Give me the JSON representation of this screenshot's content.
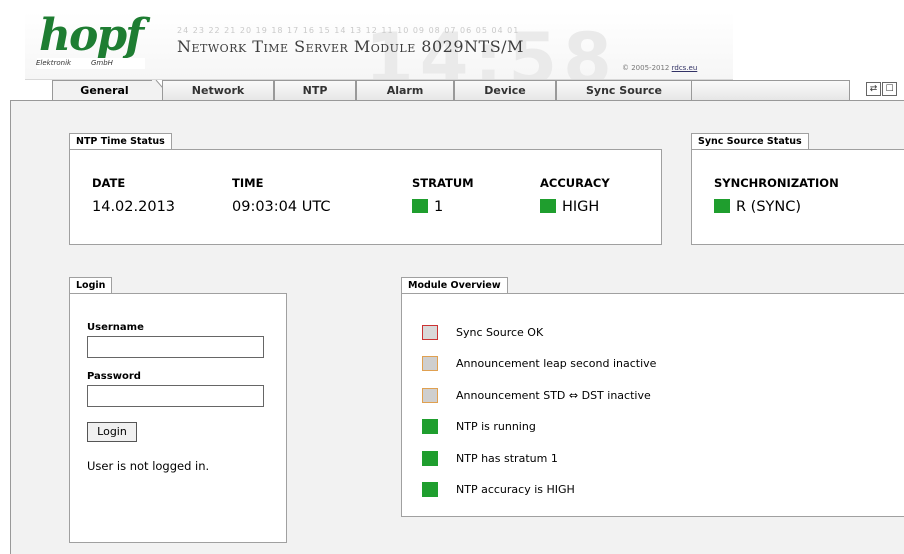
{
  "header": {
    "logo_word": "hopf",
    "logo_sub_left": "Elektronik",
    "logo_sub_right": "GmbH",
    "digit_strip": "24 23 22 21 20 19 18 17 16 15 14 13 12 11 10 09 08 07 06 05 04 01",
    "title": "Network Time Server Module 8029NTS/M",
    "copyright": "© 2005-2012",
    "copyright_link": "rdcs.eu"
  },
  "tabs": [
    {
      "label": "General",
      "active": true
    },
    {
      "label": "Network",
      "active": false
    },
    {
      "label": "NTP",
      "active": false
    },
    {
      "label": "Alarm",
      "active": false
    },
    {
      "label": "Device",
      "active": false
    },
    {
      "label": "Sync Source",
      "active": false
    }
  ],
  "window_icons": [
    "refresh-icon",
    "popout-icon"
  ],
  "ntp_status": {
    "title": "NTP Time Status",
    "date_label": "DATE",
    "date_value": "14.02.2013",
    "time_label": "TIME",
    "time_value": "09:03:04 UTC",
    "stratum_label": "STRATUM",
    "stratum_value": "1",
    "accuracy_label": "ACCURACY",
    "accuracy_value": "HIGH",
    "indicator_color": "#1f9e2e"
  },
  "sync_status": {
    "title": "Sync Source Status",
    "label": "SYNCHRONIZATION",
    "value": "R (SYNC)"
  },
  "login": {
    "title": "Login",
    "username_label": "Username",
    "username_value": "",
    "password_label": "Password",
    "password_value": "",
    "button_label": "Login",
    "status_text": "User is not logged in."
  },
  "module_overview": {
    "title": "Module Overview",
    "items": [
      {
        "text": "Sync Source OK",
        "status": "red-outline"
      },
      {
        "text": "Announcement leap second inactive",
        "status": "orange-outline"
      },
      {
        "text": "Announcement STD ⇔ DST inactive",
        "status": "orange-outline"
      },
      {
        "text": "NTP is running",
        "status": "green"
      },
      {
        "text": "NTP has stratum 1",
        "status": "green"
      },
      {
        "text": "NTP accuracy is HIGH",
        "status": "green"
      }
    ]
  },
  "colors": {
    "brand_green": "#1e7d32",
    "status_green": "#1f9e2e",
    "status_red": "#cc3333",
    "status_orange": "#e0a050",
    "content_bg": "#f2f2f2"
  }
}
